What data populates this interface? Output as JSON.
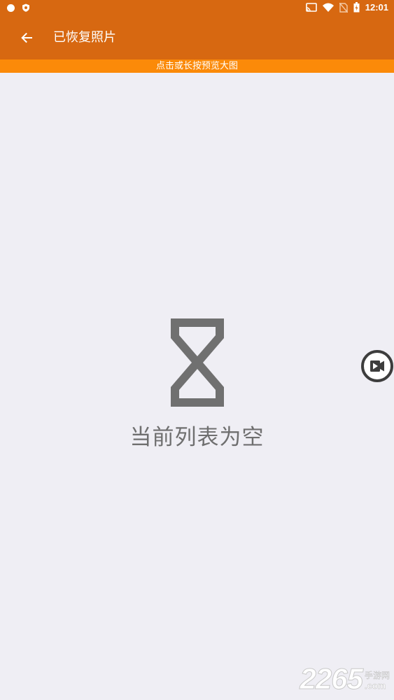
{
  "status_bar": {
    "time": "12:01",
    "icons": [
      "notification-dot-icon",
      "shield-icon",
      "cast-icon",
      "wifi-icon",
      "no-sim-icon",
      "battery-icon"
    ]
  },
  "app_bar": {
    "title": "已恢复照片",
    "back_icon": "arrow-left-icon"
  },
  "hint_bar": {
    "text": "点击或长按预览大图"
  },
  "empty_state": {
    "icon": "hourglass-icon",
    "text": "当前列表为空"
  },
  "float_button": {
    "icon": "video-play-icon"
  },
  "watermark": {
    "number": "2265",
    "cn": "手游网",
    "com": ".com"
  },
  "colors": {
    "app_bar": "#d76811",
    "hint_bar": "#fb8a09",
    "background": "#efeef4",
    "empty_icon": "#707070"
  }
}
